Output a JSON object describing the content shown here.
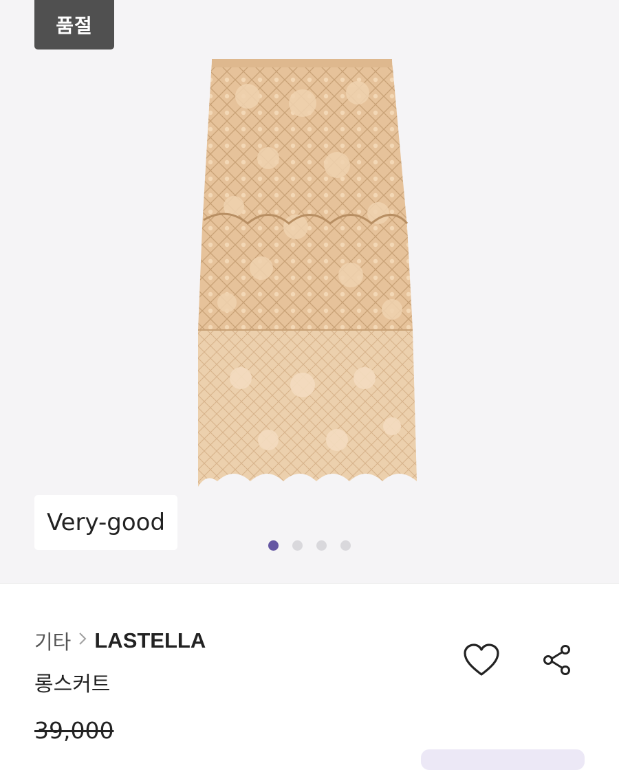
{
  "gallery": {
    "soldout_badge": "품절",
    "condition_badge": "Very-good",
    "slide_count": 4,
    "active_slide": 1
  },
  "product": {
    "category": "기타",
    "brand": "LASTELLA",
    "name": "롱스커트",
    "original_price": "39,000"
  },
  "icons": {
    "breadcrumb_separator": "chevron-right-icon",
    "like": "heart-icon",
    "share": "share-icon"
  },
  "colors": {
    "accent": "#6557a3",
    "soldout_bg": "#505050",
    "lace": "#e9c59d"
  }
}
